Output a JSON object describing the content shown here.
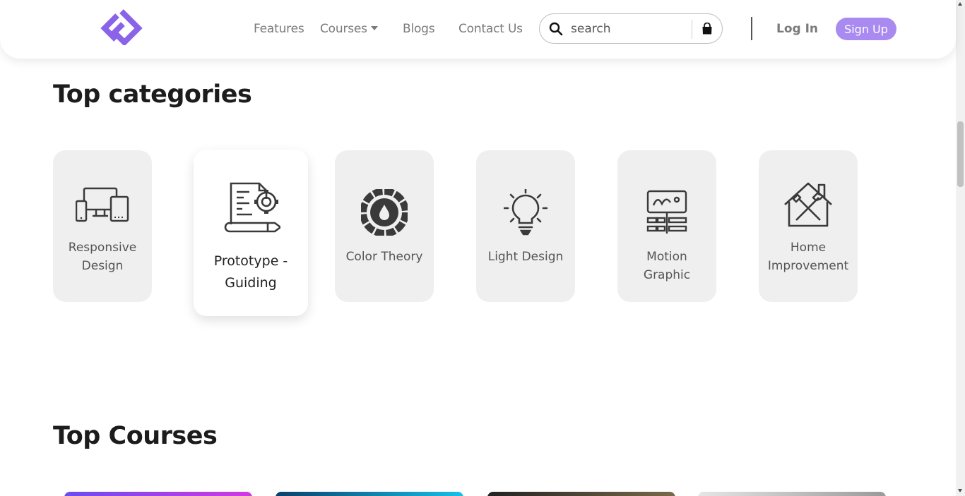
{
  "nav": {
    "features": "Features",
    "courses": "Courses",
    "blogs": "Blogs",
    "contact": "Contact Us"
  },
  "search": {
    "placeholder": "search"
  },
  "auth": {
    "login": "Log In",
    "signup": "Sign Up"
  },
  "colors": {
    "brand": "#8a63e8",
    "signup_bg": "#a98af0",
    "card_bg": "#efefef"
  },
  "sections": {
    "top_categories": "Top categories",
    "top_courses": "Top Courses"
  },
  "categories": [
    {
      "label": "Responsive Design",
      "icon": "devices-icon"
    },
    {
      "label": "Prototype - Guiding",
      "icon": "prototype-gear-icon"
    },
    {
      "label": "Color Theory",
      "icon": "color-wheel-icon"
    },
    {
      "label": "Light Design",
      "icon": "light-bulb-icon"
    },
    {
      "label": "Motion Graphic",
      "icon": "motion-graphic-icon"
    },
    {
      "label": "Home Improvement",
      "icon": "home-tools-icon"
    }
  ]
}
